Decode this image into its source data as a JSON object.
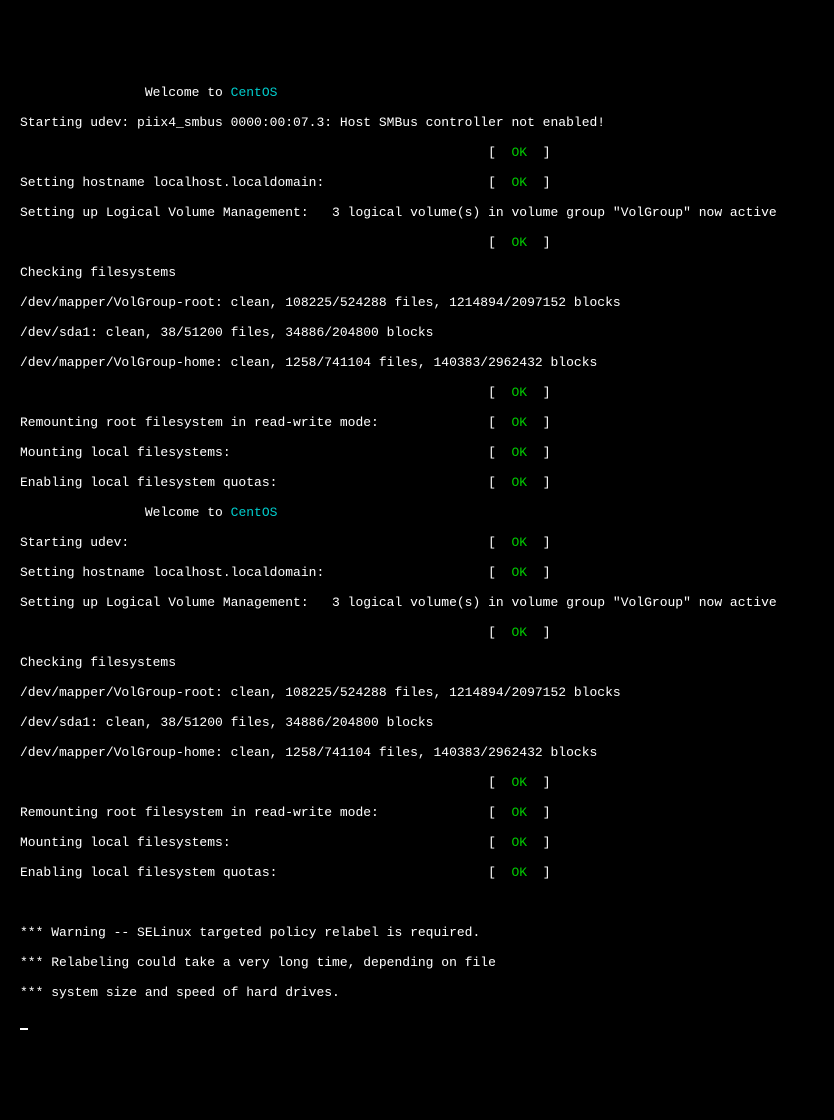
{
  "welcome_prefix": "                Welcome to ",
  "welcome_os": "CentOS",
  "ok_bracket_open": "[  ",
  "ok_text": "OK",
  "ok_bracket_close": "  ]",
  "lines": {
    "udev_piix": "Starting udev: piix4_smbus 0000:00:07.3: Host SMBus controller not enabled!",
    "ok_pad": "                                                            ",
    "hostname": "Setting hostname localhost.localdomain:                     ",
    "lvm": "Setting up Logical Volume Management:   3 logical volume(s) in volume group \"VolGroup\" now active",
    "checking_fs": "Checking filesystems",
    "fs_root": "/dev/mapper/VolGroup-root: clean, 108225/524288 files, 1214894/2097152 blocks",
    "fs_sda1": "/dev/sda1: clean, 38/51200 files, 34886/204800 blocks",
    "fs_home": "/dev/mapper/VolGroup-home: clean, 1258/741104 files, 140383/2962432 blocks",
    "remount": "Remounting root filesystem in read-write mode:              ",
    "mount_local": "Mounting local filesystems:                                 ",
    "enable_quota": "Enabling local filesystem quotas:                           ",
    "udev_start": "Starting udev:                                              ",
    "selinux1": "*** Warning -- SELinux targeted policy relabel is required.",
    "selinux2": "*** Relabeling could take a very long time, depending on file",
    "selinux3": "*** system size and speed of hard drives."
  }
}
